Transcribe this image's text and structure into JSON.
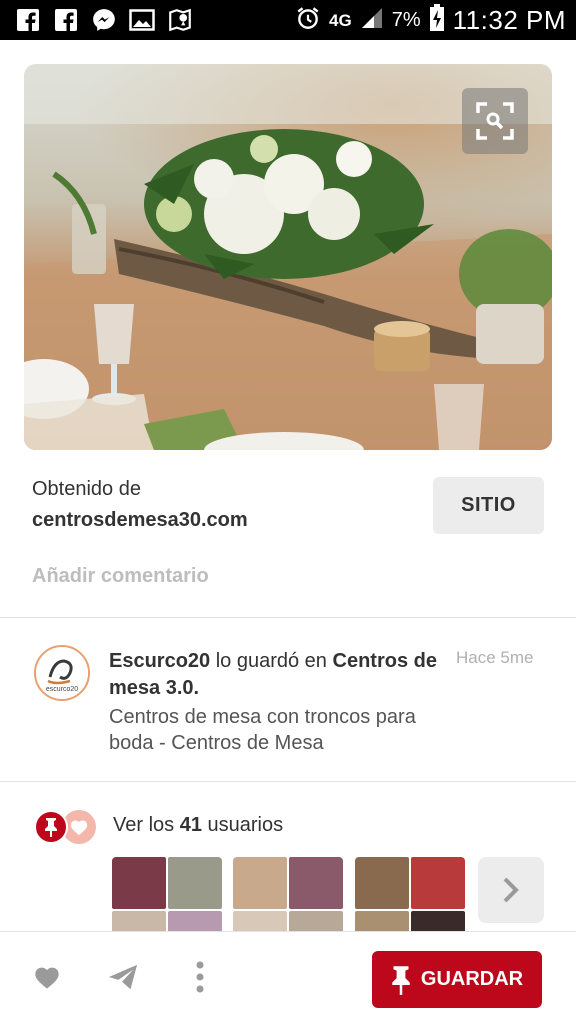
{
  "status_bar": {
    "icons": [
      "facebook-icon",
      "facebook-icon",
      "messenger-icon",
      "gallery-icon",
      "maps-icon"
    ],
    "alarm_icon": "alarm-icon",
    "network": "4G",
    "battery": "7%",
    "time": "11:32 PM"
  },
  "pin": {
    "image_icon": "visual-search-icon",
    "source_label": "Obtenido de",
    "source_domain": "centrosdemesa30.com",
    "site_button": "SITIO",
    "add_comment": "Añadir comentario"
  },
  "pinner": {
    "avatar_text": "escurco20",
    "username": "Escurco20",
    "action": " lo guardó en ",
    "board": "Centros de mesa 3.0.",
    "time": "Hace 5me",
    "description": "Centros de mesa con troncos para boda - Centros de Mesa"
  },
  "savers": {
    "prefix": "Ver los ",
    "count": "41",
    "suffix": " usuarios"
  },
  "bottom_bar": {
    "like_icon": "heart-icon",
    "send_icon": "send-icon",
    "more_icon": "more-vertical-icon",
    "save_label": "GUARDAR"
  },
  "colors": {
    "brand_red": "#bd081c",
    "muted_text": "#bdbdbd"
  }
}
